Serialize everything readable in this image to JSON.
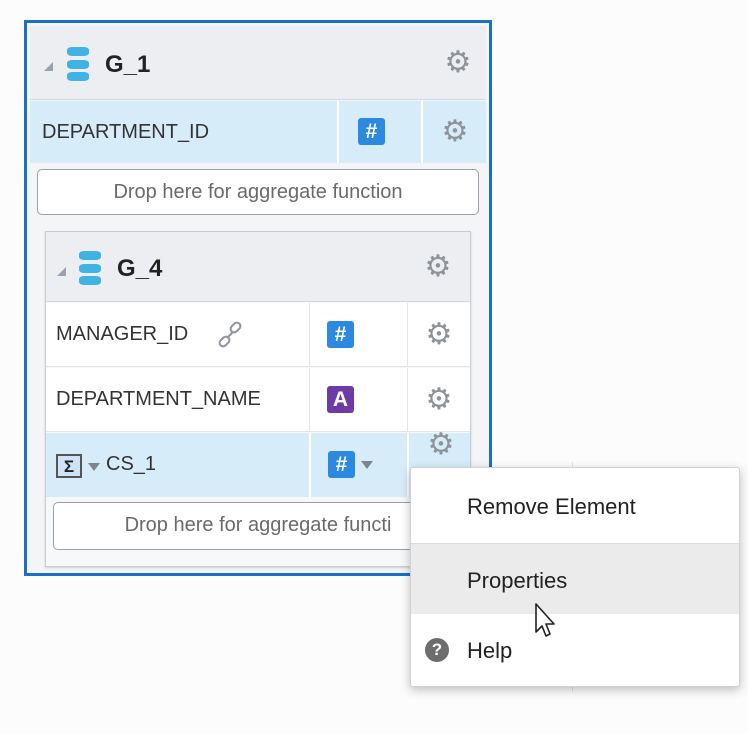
{
  "g1": {
    "title": "G_1",
    "row": {
      "label": "DEPARTMENT_ID"
    },
    "drop_zone": "Drop here for aggregate function"
  },
  "g4": {
    "title": "G_4",
    "rows": [
      {
        "label": "MANAGER_ID",
        "type_glyph": "#"
      },
      {
        "label": "DEPARTMENT_NAME",
        "type_glyph": "A"
      },
      {
        "label": "CS_1",
        "type_glyph": "#",
        "sigma": "Σ"
      }
    ],
    "drop_zone": "Drop here for aggregate functi"
  },
  "context_menu": {
    "items": [
      {
        "label": "Remove Element"
      },
      {
        "label": "Properties"
      },
      {
        "label": "Help",
        "icon_glyph": "?"
      }
    ]
  },
  "icons": {
    "gear": "gear-icon",
    "db": "database-icon",
    "link": "link-icon",
    "help": "help-icon",
    "sigma": "sigma-icon",
    "cursor": "cursor-icon"
  },
  "colors": {
    "accent": "#1a6fc9",
    "selection": "#d7ecf9",
    "number": "#2b8ae0",
    "text_type": "#6e3aa3",
    "db": "#3fb3e4"
  }
}
